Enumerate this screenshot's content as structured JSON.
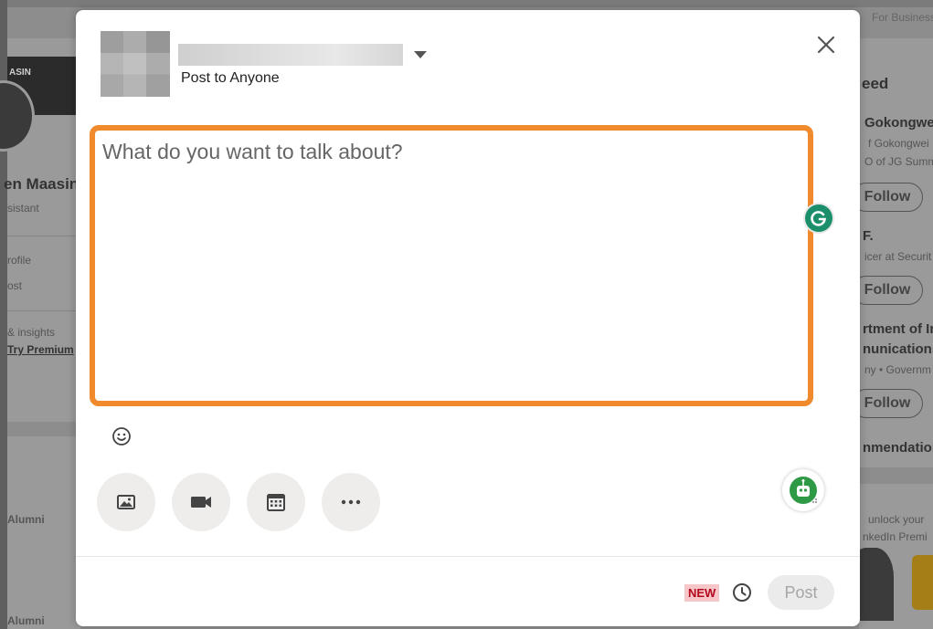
{
  "background": {
    "left_banner_text": "ASIN",
    "left_name": "en Maasin",
    "left_role": "sistant",
    "left_profile_link": "rofile",
    "left_post_link": "ost",
    "left_insights": "& insights",
    "left_premium": "Try Premium",
    "left_alumni_1": "Alumni",
    "left_alumni_2": "Alumni",
    "top_right": "For Business",
    "right_feed": "eed",
    "right_person_1_name": "Gokongwei",
    "right_person_1_line1": "f Gokongwei",
    "right_person_1_line2": "O of JG Summ",
    "right_person_2_name": "F.",
    "right_person_2_line1": "icer at Securit",
    "right_org_line1": "rtment of In",
    "right_org_line2": "nunications",
    "right_org_line3": "ny • Governm",
    "follow_label": "Follow",
    "right_recommendation": "nmendation",
    "right_premium_1": "unlock your",
    "right_premium_2": "nkedIn Premi"
  },
  "modal": {
    "audience_label": "Post to Anyone",
    "editor_placeholder": "What do you want to talk about?",
    "new_badge": "NEW",
    "post_button": "Post"
  },
  "colors": {
    "editor_highlight": "#f08a2c",
    "grammarly": "#1b8f6c",
    "new_badge_bg": "#f7c6c8",
    "new_badge_text": "#b3081d"
  },
  "icons": {
    "close": "close-icon",
    "emoji": "emoji-icon",
    "photo": "image-icon",
    "video": "video-icon",
    "event": "calendar-icon",
    "more": "more-icon",
    "schedule": "clock-icon",
    "grammarly": "grammarly-icon",
    "assistant": "assistant-bot-icon"
  }
}
